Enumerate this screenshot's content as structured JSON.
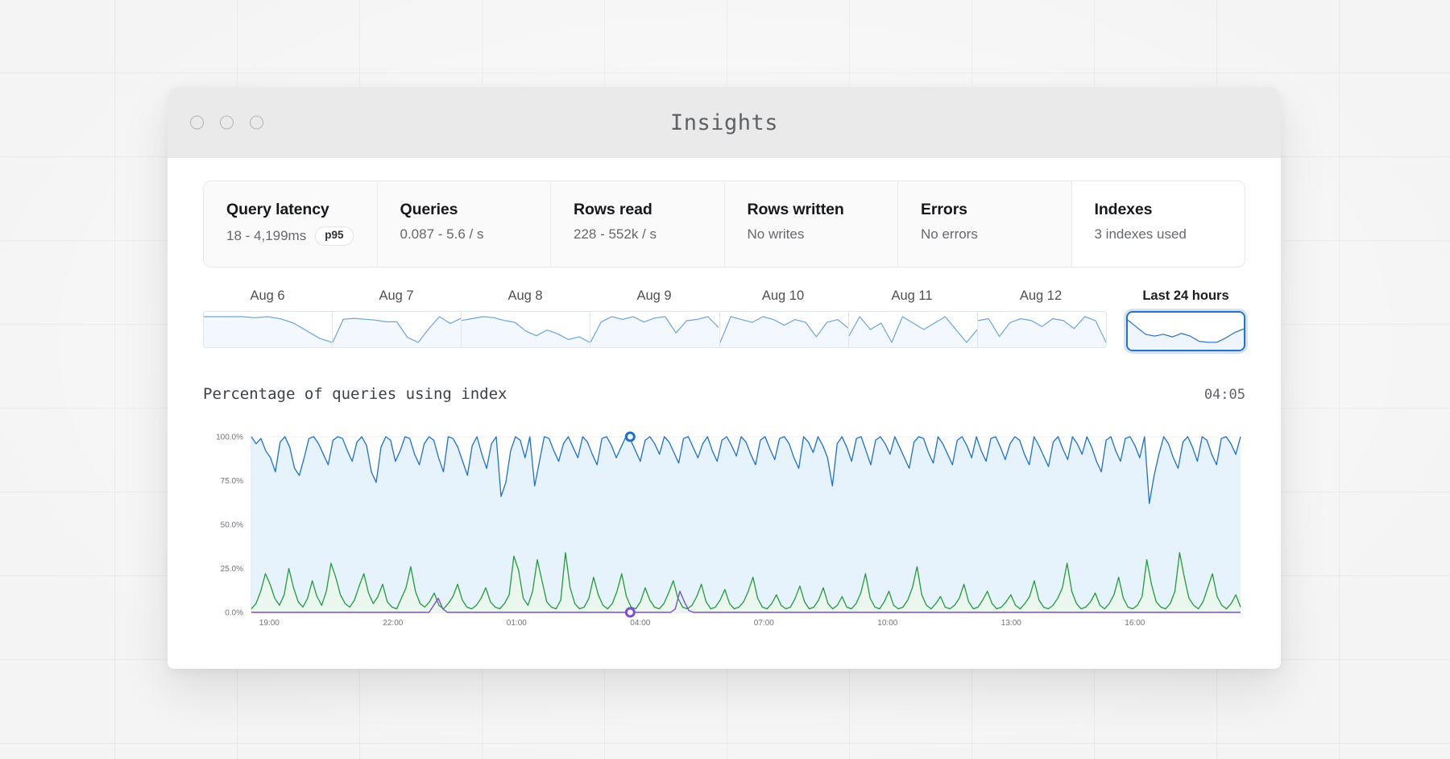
{
  "window": {
    "title": "Insights",
    "traffic_lights": [
      "close-dot",
      "minimize-dot",
      "maximize-dot"
    ]
  },
  "metric_tabs": [
    {
      "title": "Query latency",
      "value": "18 - 4,199ms",
      "badge": "p95",
      "selected": false
    },
    {
      "title": "Queries",
      "value": "0.087 - 5.6 / s",
      "badge": "",
      "selected": false
    },
    {
      "title": "Rows read",
      "value": "228 - 552k / s",
      "badge": "",
      "selected": false
    },
    {
      "title": "Rows written",
      "value": "No writes",
      "badge": "",
      "selected": false
    },
    {
      "title": "Errors",
      "value": "No errors",
      "badge": "",
      "selected": false
    },
    {
      "title": "Indexes",
      "value": "3 indexes used",
      "badge": "",
      "selected": true
    }
  ],
  "range_selector": {
    "days": [
      {
        "label": "Aug 6",
        "sparkline": [
          30,
          30,
          30,
          30,
          29,
          30,
          28,
          24,
          17,
          10,
          6
        ]
      },
      {
        "label": "Aug 7",
        "sparkline": [
          6,
          33,
          34,
          33,
          32,
          30,
          30,
          12,
          6,
          22,
          36,
          28,
          34
        ]
      },
      {
        "label": "Aug 8",
        "sparkline": [
          34,
          36,
          38,
          37,
          34,
          32,
          23,
          18,
          24,
          20,
          14,
          17,
          11
        ]
      },
      {
        "label": "Aug 9",
        "sparkline": [
          11,
          26,
          30,
          28,
          30,
          26,
          29,
          30,
          18,
          27,
          28,
          30,
          22
        ]
      },
      {
        "label": "Aug 10",
        "sparkline": [
          22,
          31,
          30,
          29,
          31,
          30,
          28,
          30,
          29,
          24,
          29,
          30,
          27
        ]
      },
      {
        "label": "Aug 11",
        "sparkline": [
          27,
          30,
          28,
          29,
          26,
          30,
          29,
          28,
          29,
          30,
          28,
          26,
          28
        ]
      },
      {
        "label": "Aug 12",
        "sparkline": [
          28,
          29,
          20,
          27,
          29,
          28,
          25,
          29,
          28,
          24,
          30,
          28,
          17
        ]
      }
    ],
    "selected": {
      "label": "Last 24 hours",
      "sparkline": [
        34,
        26,
        18,
        16,
        18,
        15,
        19,
        16,
        10,
        9,
        9,
        14,
        20,
        24
      ]
    }
  },
  "chart_data": {
    "type": "line",
    "title": "Percentage of queries using index",
    "timestamp": "04:05",
    "xlabel": "",
    "ylabel": "",
    "ylim": [
      0,
      100
    ],
    "grid": true,
    "legend": "none",
    "y_ticks": [
      "0.0%",
      "25.0%",
      "50.0%",
      "75.0%",
      "100.0%"
    ],
    "y_tick_values": [
      0,
      25,
      50,
      75,
      100
    ],
    "x_ticks": [
      "19:00",
      "22:00",
      "01:00",
      "04:00",
      "07:00",
      "10:00",
      "13:00",
      "16:00"
    ],
    "x_tick_positions": [
      0.8,
      13.3,
      25.8,
      38.3,
      50.8,
      63.3,
      75.8,
      88.3
    ],
    "colors": {
      "index_used": "#1d6fd0",
      "other": "#1f9c3c",
      "third": "#7b4fd4",
      "area_fill": "#e3f1fb"
    },
    "markers": [
      {
        "series": "index_used",
        "x_label": "04:00",
        "value": 100.0,
        "color": "#1d6fd0"
      },
      {
        "series": "third",
        "x_label": "04:00",
        "value": 0.0,
        "color": "#7b4fd4"
      }
    ],
    "series": [
      {
        "name": "index_used",
        "color": "#1d6fd0",
        "values": [
          100,
          96,
          99,
          92,
          88,
          80,
          97,
          100,
          94,
          82,
          78,
          88,
          99,
          100,
          96,
          90,
          84,
          98,
          100,
          99,
          92,
          86,
          97,
          100,
          95,
          80,
          74,
          94,
          100,
          98,
          86,
          92,
          100,
          99,
          90,
          84,
          96,
          100,
          98,
          88,
          80,
          100,
          99,
          94,
          86,
          78,
          95,
          100,
          90,
          82,
          96,
          100,
          66,
          74,
          92,
          100,
          98,
          88,
          100,
          72,
          86,
          100,
          99,
          92,
          86,
          96,
          100,
          94,
          88,
          100,
          97,
          90,
          84,
          99,
          100,
          95,
          88,
          94,
          100,
          98,
          92,
          86,
          98,
          100,
          96,
          90,
          100,
          97,
          91,
          85,
          99,
          100,
          94,
          88,
          96,
          100,
          92,
          86,
          98,
          100,
          95,
          89,
          100,
          97,
          90,
          84,
          98,
          100,
          93,
          87,
          99,
          100,
          96,
          88,
          82,
          100,
          97,
          91,
          100,
          95,
          88,
          72,
          96,
          100,
          94,
          86,
          99,
          100,
          92,
          84,
          98,
          100,
          96,
          90,
          100,
          94,
          88,
          82,
          97,
          100,
          99,
          91,
          85,
          100,
          96,
          90,
          84,
          98,
          100,
          95,
          88,
          100,
          92,
          86,
          99,
          100,
          94,
          87,
          96,
          100,
          98,
          90,
          84,
          100,
          95,
          89,
          83,
          97,
          100,
          93,
          87,
          100,
          96,
          90,
          100,
          94,
          86,
          80,
          98,
          100,
          92,
          86,
          99,
          100,
          95,
          88,
          100,
          62,
          78,
          90,
          100,
          96,
          88,
          82,
          97,
          100,
          94,
          86,
          100,
          98,
          90,
          84,
          99,
          100,
          96,
          90,
          100
        ]
      },
      {
        "name": "other",
        "color": "#1f9c3c",
        "values": [
          2,
          5,
          12,
          22,
          16,
          8,
          4,
          10,
          25,
          14,
          6,
          3,
          8,
          18,
          9,
          4,
          12,
          28,
          20,
          10,
          5,
          3,
          7,
          15,
          22,
          11,
          5,
          9,
          16,
          6,
          3,
          2,
          8,
          14,
          26,
          12,
          5,
          3,
          6,
          11,
          4,
          2,
          5,
          9,
          16,
          7,
          3,
          2,
          4,
          8,
          14,
          6,
          3,
          2,
          5,
          10,
          32,
          24,
          8,
          4,
          12,
          30,
          18,
          6,
          3,
          2,
          7,
          34,
          14,
          5,
          2,
          3,
          8,
          20,
          10,
          4,
          2,
          5,
          12,
          22,
          9,
          3,
          2,
          6,
          14,
          7,
          3,
          2,
          5,
          11,
          18,
          8,
          3,
          2,
          4,
          9,
          16,
          6,
          2,
          3,
          7,
          13,
          5,
          2,
          3,
          6,
          12,
          20,
          8,
          3,
          2,
          5,
          10,
          4,
          2,
          3,
          8,
          15,
          6,
          2,
          3,
          7,
          14,
          5,
          2,
          4,
          9,
          3,
          2,
          5,
          11,
          22,
          8,
          3,
          2,
          6,
          12,
          4,
          2,
          3,
          7,
          14,
          26,
          10,
          4,
          2,
          5,
          9,
          3,
          2,
          4,
          8,
          16,
          6,
          2,
          3,
          7,
          12,
          5,
          2,
          3,
          6,
          10,
          4,
          2,
          5,
          9,
          18,
          7,
          3,
          2,
          4,
          8,
          14,
          28,
          12,
          5,
          2,
          3,
          6,
          11,
          4,
          2,
          5,
          10,
          20,
          8,
          3,
          2,
          4,
          9,
          30,
          16,
          6,
          3,
          2,
          5,
          12,
          34,
          20,
          8,
          4,
          2,
          6,
          14,
          22,
          9,
          4,
          2,
          5,
          10,
          3
        ]
      },
      {
        "name": "third",
        "color": "#7b4fd4",
        "values": [
          0,
          0,
          0,
          0,
          0,
          0,
          0,
          0,
          0,
          0,
          0,
          0,
          0,
          0,
          0,
          0,
          0,
          0,
          0,
          0,
          0,
          0,
          0,
          0,
          0,
          0,
          0,
          0,
          0,
          0,
          0,
          0,
          0,
          0,
          0,
          0,
          0,
          0,
          0,
          0,
          4,
          8,
          2,
          0,
          0,
          0,
          0,
          0,
          0,
          0,
          0,
          0,
          0,
          0,
          0,
          0,
          0,
          0,
          0,
          0,
          0,
          0,
          0,
          0,
          0,
          0,
          0,
          0,
          0,
          0,
          0,
          0,
          0,
          0,
          0,
          0,
          0,
          0,
          0,
          0,
          0,
          0,
          0,
          0,
          0,
          0,
          0,
          0,
          0,
          0,
          0,
          0,
          0,
          2,
          12,
          6,
          1,
          0,
          0,
          0,
          0,
          0,
          0,
          0,
          0,
          0,
          0,
          0,
          0,
          0,
          0,
          0,
          0,
          0,
          0,
          0,
          0,
          0,
          0,
          0,
          0,
          0,
          0,
          0,
          0,
          0,
          0,
          0,
          0,
          0,
          0,
          0,
          0,
          0,
          0,
          0,
          0,
          0,
          0,
          0,
          0,
          0,
          0,
          0,
          0,
          0,
          0,
          0,
          0,
          0,
          0,
          0,
          0,
          0,
          0,
          0,
          0,
          0,
          0,
          0,
          0,
          0,
          0,
          0,
          0,
          0,
          0,
          0,
          0,
          0,
          0,
          0,
          0,
          0,
          0,
          0,
          0,
          0,
          0,
          0,
          0,
          0,
          0,
          0,
          0,
          0,
          0,
          0,
          0,
          0,
          0,
          0,
          0,
          0,
          0,
          0,
          0,
          0,
          0,
          0,
          0,
          0,
          0,
          0,
          0,
          0,
          0,
          0,
          0,
          0,
          0,
          0,
          0,
          0,
          0,
          0,
          0,
          0
        ]
      },
      {
        "name": "third_spike",
        "color": "#7b4fd4",
        "values": []
      }
    ]
  }
}
